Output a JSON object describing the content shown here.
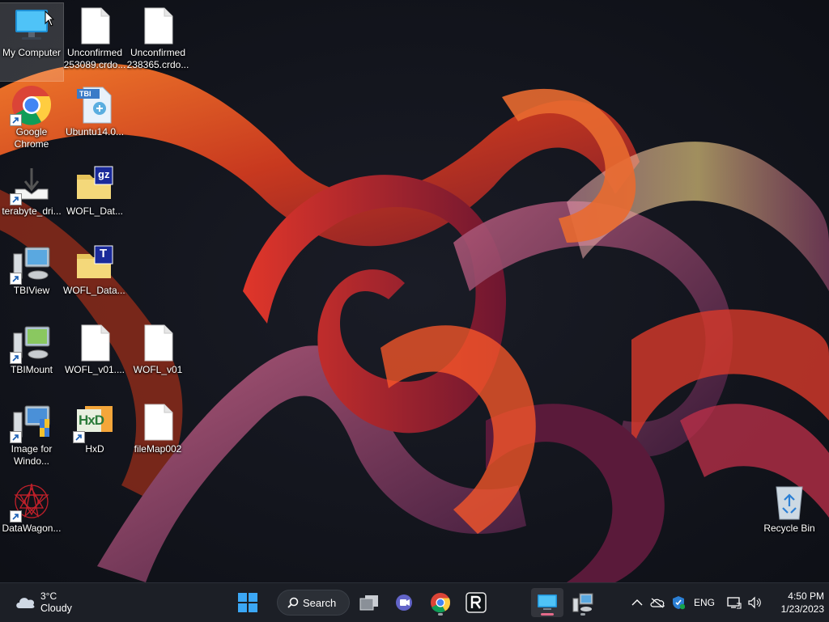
{
  "desktop": {
    "icons": [
      {
        "id": "my-computer",
        "label": "My Computer",
        "type": "monitor",
        "shortcut": false,
        "selected": true
      },
      {
        "id": "unconfirmed-1",
        "label": "Unconfirmed\n253089.crdo...",
        "type": "blank",
        "shortcut": false
      },
      {
        "id": "unconfirmed-2",
        "label": "Unconfirmed\n238365.crdo...",
        "type": "blank",
        "shortcut": false
      },
      {
        "id": "google-chrome",
        "label": "Google\nChrome",
        "type": "chrome",
        "shortcut": true
      },
      {
        "id": "ubuntu",
        "label": "Ubuntu14.0...",
        "type": "tbi",
        "badge": "TBI",
        "shortcut": false
      },
      {
        "id": "terabyte-dri",
        "label": "terabyte_dri...",
        "type": "download",
        "shortcut": true
      },
      {
        "id": "wofl-dat-gz",
        "label": "WOFL_Dat...",
        "type": "folder",
        "badge": "gz",
        "shortcut": false
      },
      {
        "id": "tbiview",
        "label": "TBIView",
        "type": "pc",
        "shortcut": true
      },
      {
        "id": "wofl-data-t",
        "label": "WOFL_Data....",
        "type": "folder",
        "badge": "T",
        "shortcut": false
      },
      {
        "id": "tbimount",
        "label": "TBIMount",
        "type": "pc",
        "shortcut": true
      },
      {
        "id": "wofl-v01-a",
        "label": "WOFL_v01....",
        "type": "blank",
        "shortcut": false
      },
      {
        "id": "wofl-v01-b",
        "label": "WOFL_v01",
        "type": "blank",
        "shortcut": false
      },
      {
        "id": "image-for-windows",
        "label": "Image for\nWindo...",
        "type": "pc-shield",
        "shortcut": true
      },
      {
        "id": "hxd",
        "label": "HxD",
        "type": "hxd",
        "badge": "HxD",
        "shortcut": true
      },
      {
        "id": "filemap002",
        "label": "fileMap002",
        "type": "blank",
        "shortcut": false
      },
      {
        "id": "datawagon",
        "label": "DataWagon...",
        "type": "datawagon",
        "shortcut": true
      },
      {
        "id": "recycle-bin",
        "label": "Recycle Bin",
        "type": "recycle",
        "shortcut": false
      }
    ]
  },
  "taskbar": {
    "weather": {
      "temp": "3°C",
      "condition": "Cloudy"
    },
    "search_label": "Search",
    "apps": [
      {
        "id": "start",
        "icon": "windows-logo-icon"
      },
      {
        "id": "task-view",
        "icon": "task-view-icon"
      },
      {
        "id": "meet",
        "icon": "meet-icon"
      },
      {
        "id": "chrome",
        "icon": "chrome-icon",
        "running": true
      },
      {
        "id": "r-app",
        "icon": "r-app-icon"
      },
      {
        "id": "my-computer",
        "icon": "monitor-icon",
        "running": true,
        "active": true
      },
      {
        "id": "network-pc",
        "icon": "network-pc-icon",
        "running": true
      }
    ],
    "tray": {
      "language": "ENG",
      "time": "4:50 PM",
      "date": "1/23/2023"
    },
    "colors": {
      "accent": "#e46a8a",
      "taskbar": "#1c1f26"
    }
  }
}
